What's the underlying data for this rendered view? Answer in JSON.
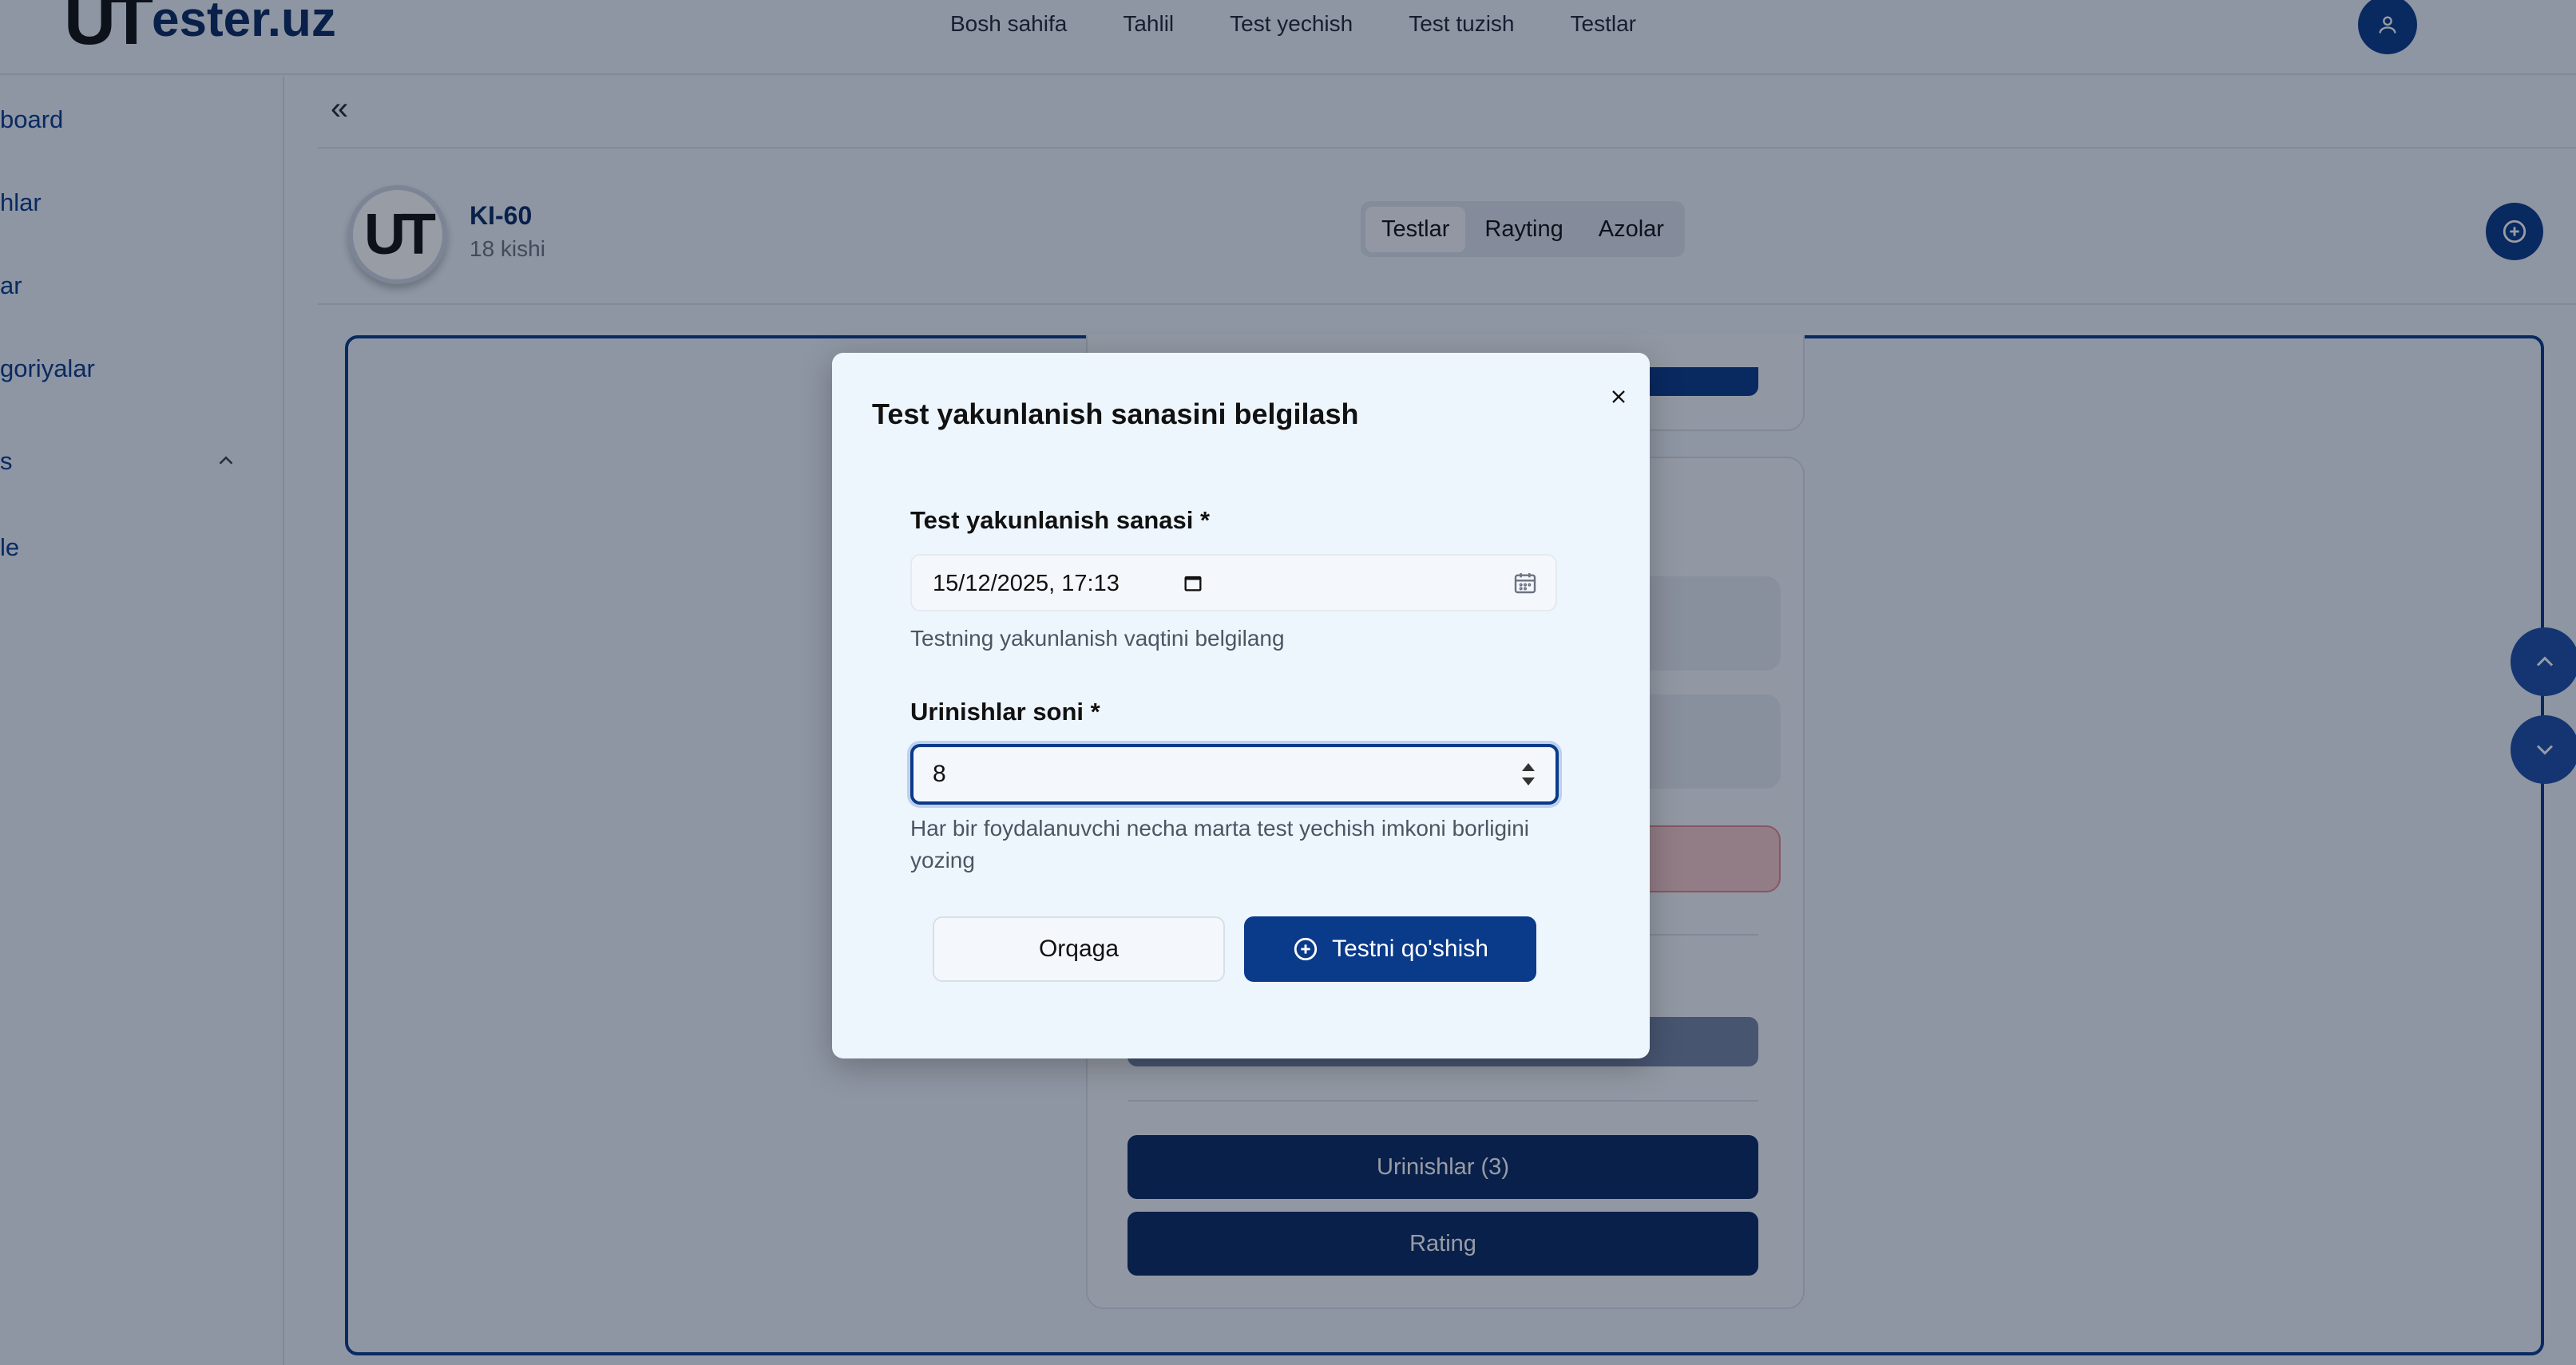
{
  "brand": {
    "mark": "UT",
    "name": "ester.uz"
  },
  "topnav": {
    "items": [
      "Bosh sahifa",
      "Tahlil",
      "Test yechish",
      "Test tuzish",
      "Testlar"
    ]
  },
  "sidebar": {
    "items": [
      "board",
      "hlar",
      "ar",
      "goriyalar",
      "s",
      "le"
    ]
  },
  "group": {
    "avatar_text": "UT",
    "name": "KI-60",
    "members": "18 kishi"
  },
  "tabs": {
    "items": [
      "Testlar",
      "Rayting",
      "Azolar"
    ],
    "active": "Testlar"
  },
  "card": {
    "attempts_button": "Urinishlar (3)",
    "rating_button": "Rating"
  },
  "modal": {
    "title": "Test yakunlanish sanasini belgilash",
    "date_label": "Test yakunlanish sanasi *",
    "date_value": "15/12/2025, 17:13",
    "date_helper": "Testning yakunlanish vaqtini belgilang",
    "attempts_label": "Urinishlar soni *",
    "attempts_value": "8",
    "attempts_helper": "Har bir foydalanuvchi necha marta test yechish imkoni borligini yozing",
    "back_button": "Orqaga",
    "add_button": "Testni qo'shish"
  },
  "icons": {
    "user": "user-icon",
    "collapse": "double-chevron-left-icon",
    "add": "plus-circle-icon",
    "close": "close-icon",
    "calendar": "calendar-icon",
    "chevron_up": "chevron-up-icon",
    "chevron_down": "chevron-down-icon",
    "spinner": "number-spinner-icon"
  },
  "colors": {
    "primary": "#0a3a8a",
    "primary_dark": "#0a2a63",
    "background": "#eef5fc"
  }
}
